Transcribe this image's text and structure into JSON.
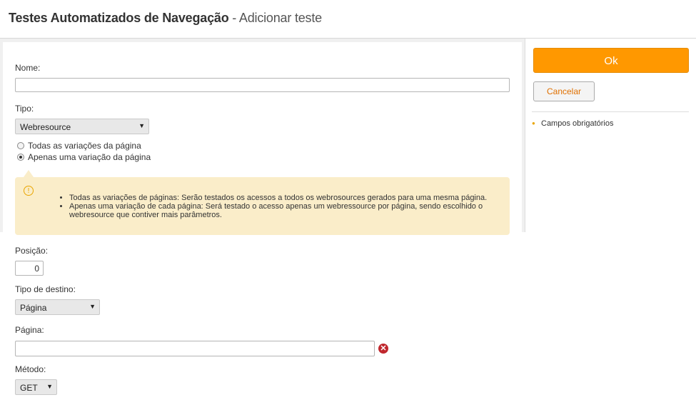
{
  "header": {
    "title_bold": "Testes Automatizados de Navegação",
    "title_sep": " - ",
    "title_sub": "Adicionar teste"
  },
  "form": {
    "nome_label": "Nome:",
    "nome_value": "",
    "tipo_label": "Tipo:",
    "tipo_selected": "Webresource",
    "radio_all": "Todas as variações da página",
    "radio_one": "Apenas uma variação da página",
    "radio_selected": "radio_one",
    "info_items": [
      "Todas as variações de páginas: Serão testados os acessos a todos os webrosources gerados para uma mesma página.",
      "Apenas uma variação de cada página: Será testado o acesso apenas um webressource por página, sendo escolhido o webresource que contiver mais parâmetros."
    ],
    "posicao_label": "Posição:",
    "posicao_value": "0",
    "tipo_destino_label": "Tipo de destino:",
    "tipo_destino_selected": "Página",
    "pagina_label": "Página:",
    "pagina_value": "",
    "metodo_label": "Método:",
    "metodo_selected": "GET"
  },
  "sidebar": {
    "ok_label": "Ok",
    "cancel_label": "Cancelar",
    "required_note": "Campos obrigatórios"
  },
  "colors": {
    "accent": "#ff9800",
    "info_bg": "#faedc9",
    "danger": "#c0272d"
  },
  "icons": {
    "warning": "warning-icon",
    "clear": "clear-icon",
    "dropdown": "chevron-down-icon"
  }
}
